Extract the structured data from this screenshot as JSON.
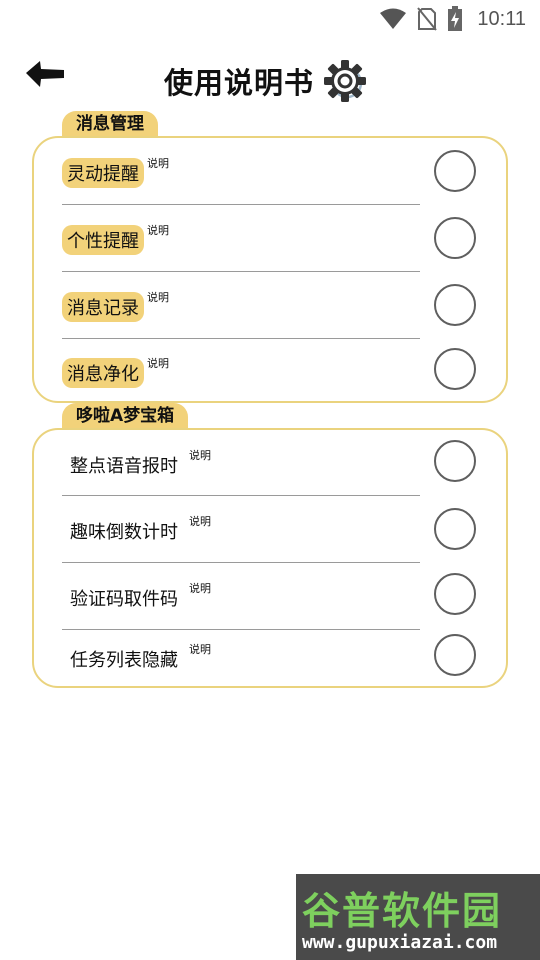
{
  "status_bar": {
    "time": "10:11",
    "icons": [
      "wifi-icon",
      "no-sim-icon",
      "battery-charging-icon"
    ]
  },
  "header": {
    "title": "使用说明书",
    "back_icon": "arrow-left-icon",
    "settings_icon": "gear-icon"
  },
  "sections": [
    {
      "title": "消息管理",
      "items": [
        {
          "label": "灵动提醒",
          "note": "说明",
          "highlighted": true,
          "on": false
        },
        {
          "label": "个性提醒",
          "note": "说明",
          "highlighted": true,
          "on": false
        },
        {
          "label": "消息记录",
          "note": "说明",
          "highlighted": true,
          "on": false
        },
        {
          "label": "消息净化",
          "note": "说明",
          "highlighted": true,
          "on": false
        }
      ]
    },
    {
      "title": "哆啦A梦宝箱",
      "items": [
        {
          "label": "整点语音报时",
          "note": "说明",
          "highlighted": false,
          "on": false
        },
        {
          "label": "趣味倒数计时",
          "note": "说明",
          "highlighted": false,
          "on": false
        },
        {
          "label": "验证码取件码",
          "note": "说明",
          "highlighted": false,
          "on": false
        },
        {
          "label": "任务列表隐藏",
          "note": "说明",
          "highlighted": false,
          "on": false
        }
      ]
    }
  ],
  "watermark": {
    "name": "谷普软件园",
    "url": "www.gupuxiazai.com"
  },
  "colors": {
    "accent": "#f2d27a",
    "card_border": "#ead37e",
    "toggle_border": "#5f5f5f",
    "watermark_green": "#7ed05e"
  }
}
